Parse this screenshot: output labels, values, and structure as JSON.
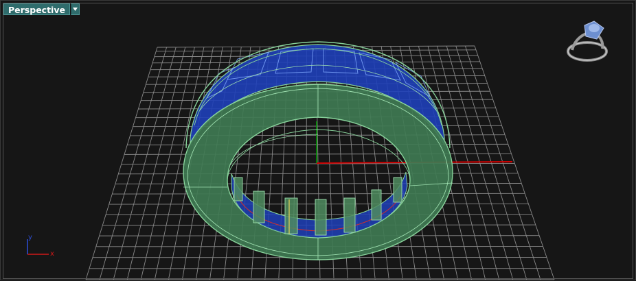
{
  "viewport": {
    "name": "Perspective",
    "dropdown_icon": "triangle-down-icon",
    "axes_widget": {
      "x_label": "x",
      "y_label": "y",
      "x_color": "#d01818",
      "y_color": "#2d4fd8"
    },
    "navigation_thumbnail_icon": "ring-preview-icon"
  },
  "colors": {
    "background": "#161616",
    "grid": "#8a8a8a",
    "x_axis": "#d00000",
    "y_axis": "#00a000",
    "ring_metal": "#4f8c5f",
    "ring_edges": "#88d39b",
    "stones": "#1e3fb8",
    "tab": "#2f6c6c"
  }
}
